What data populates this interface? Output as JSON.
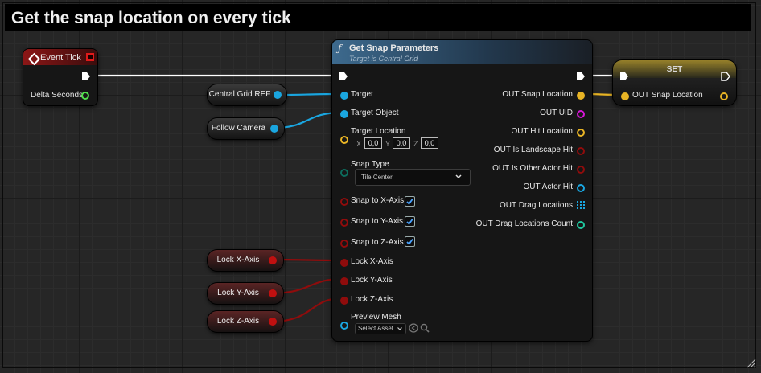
{
  "comment": {
    "title": "Get the snap location on every tick"
  },
  "event_tick": {
    "title": "Event Tick",
    "pins": {
      "delta_seconds": "Delta Seconds"
    }
  },
  "get_snap": {
    "title": "Get Snap Parameters",
    "subtitle": "Target is Central Grid",
    "inputs": {
      "target": "Target",
      "target_object": "Target Object",
      "target_location": "Target Location",
      "snap_type": "Snap Type",
      "snap_x": "Snap to X-Axis",
      "snap_y": "Snap to Y-Axis",
      "snap_z": "Snap to Z-Axis",
      "lock_x": "Lock X-Axis",
      "lock_y": "Lock Y-Axis",
      "lock_z": "Lock Z-Axis",
      "preview_mesh": "Preview Mesh"
    },
    "vector": {
      "x_label": "X",
      "y_label": "Y",
      "z_label": "Z",
      "x": "0,0",
      "y": "0,0",
      "z": "0,0"
    },
    "snap_type_value": "Tile Center",
    "preview_mesh_value": "Select Asset",
    "snap_checked": {
      "x": true,
      "y": true,
      "z": true
    },
    "outputs": {
      "snap_location": "OUT Snap Location",
      "uid": "OUT UID",
      "hit_location": "OUT Hit Location",
      "is_landscape_hit": "OUT Is Landscape Hit",
      "is_other_actor_hit": "OUT Is Other Actor Hit",
      "actor_hit": "OUT Actor Hit",
      "drag_locations": "OUT Drag Locations",
      "drag_locations_count": "OUT Drag Locations Count"
    }
  },
  "set_node": {
    "title": "SET",
    "pin": "OUT Snap Location"
  },
  "variables": {
    "central_grid_ref": "Central Grid REF",
    "follow_camera": "Follow Camera",
    "lock_x": "Lock X-Axis",
    "lock_y": "Lock Y-Axis",
    "lock_z": "Lock Z-Axis"
  },
  "colors": {
    "exec": "#ffffff",
    "object": "#1aa6e0",
    "vector": "#e8b425",
    "boolean": "#8f0c0c",
    "float": "#52e04d",
    "string": "#d616d6",
    "byte": "#0d6b5c",
    "function_header": "#3d6a8e",
    "event_header": "#8c1616",
    "set_header": "#a28a2a"
  },
  "icons": {
    "function": "function-icon",
    "event": "event-diamond-icon",
    "delegate": "delegate-square-icon",
    "dropdown": "chevron-down-icon",
    "browse": "browse-icon",
    "search": "search-icon"
  }
}
